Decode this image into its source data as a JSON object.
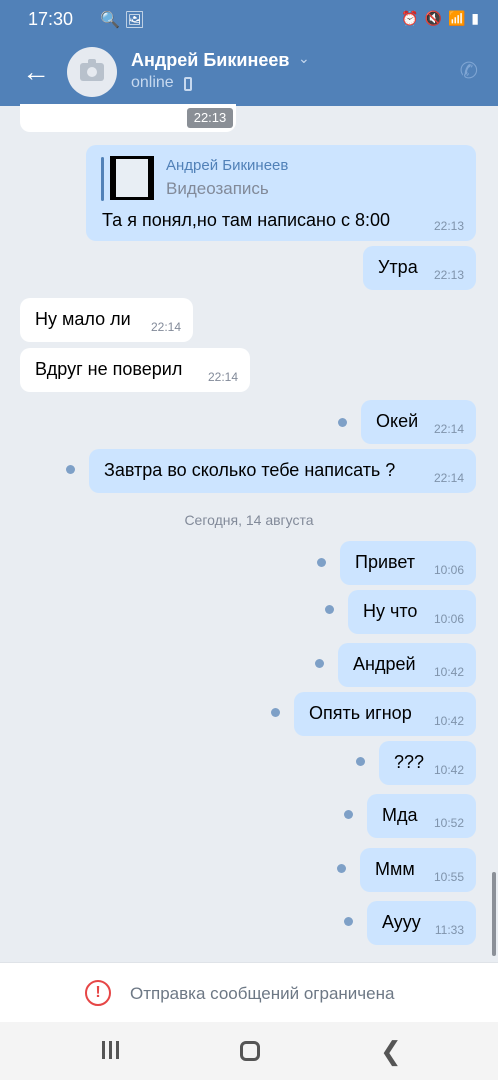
{
  "status_bar": {
    "time": "17:30",
    "left_icons": "🔍 🖼",
    "right_icons": "⏰ 🔇 📶 ▮"
  },
  "header": {
    "back_icon": "arrow-left-icon",
    "contact_name": "Андрей Бикинеев",
    "status": "online",
    "call_icon": "phone-icon"
  },
  "top_time": "22:13",
  "reply": {
    "author": "Андрей Бикинеев",
    "kind": "Видеозапись"
  },
  "messages": [
    {
      "text": "Та я понял,но там написано с 8:00",
      "time": "22:13"
    },
    {
      "text": "Утра",
      "time": "22:13"
    },
    {
      "text": "Ну мало ли",
      "time": "22:14"
    },
    {
      "text": "Вдруг не поверил",
      "time": "22:14"
    },
    {
      "text": "Окей",
      "time": "22:14"
    },
    {
      "text": "Завтра во сколько тебе написать ?",
      "time": "22:14"
    },
    {
      "text": "Привет",
      "time": "10:06"
    },
    {
      "text": "Ну что",
      "time": "10:06"
    },
    {
      "text": "Андрей",
      "time": "10:42"
    },
    {
      "text": "Опять игнор",
      "time": "10:42"
    },
    {
      "text": "???",
      "time": "10:42"
    },
    {
      "text": "Мда",
      "time": "10:52"
    },
    {
      "text": "Ммм",
      "time": "10:55"
    },
    {
      "text": "Аууу",
      "time": "11:33"
    }
  ],
  "date_separator": "Сегодня, 14 августа",
  "footer": {
    "warning_icon": "!",
    "text": "Отправка сообщений ограничена"
  },
  "colors": {
    "header": "#5181b8",
    "outgoing_bubble": "#cce4ff",
    "incoming_bubble": "#ffffff",
    "background": "#e9edf2",
    "warning": "#e64646"
  }
}
